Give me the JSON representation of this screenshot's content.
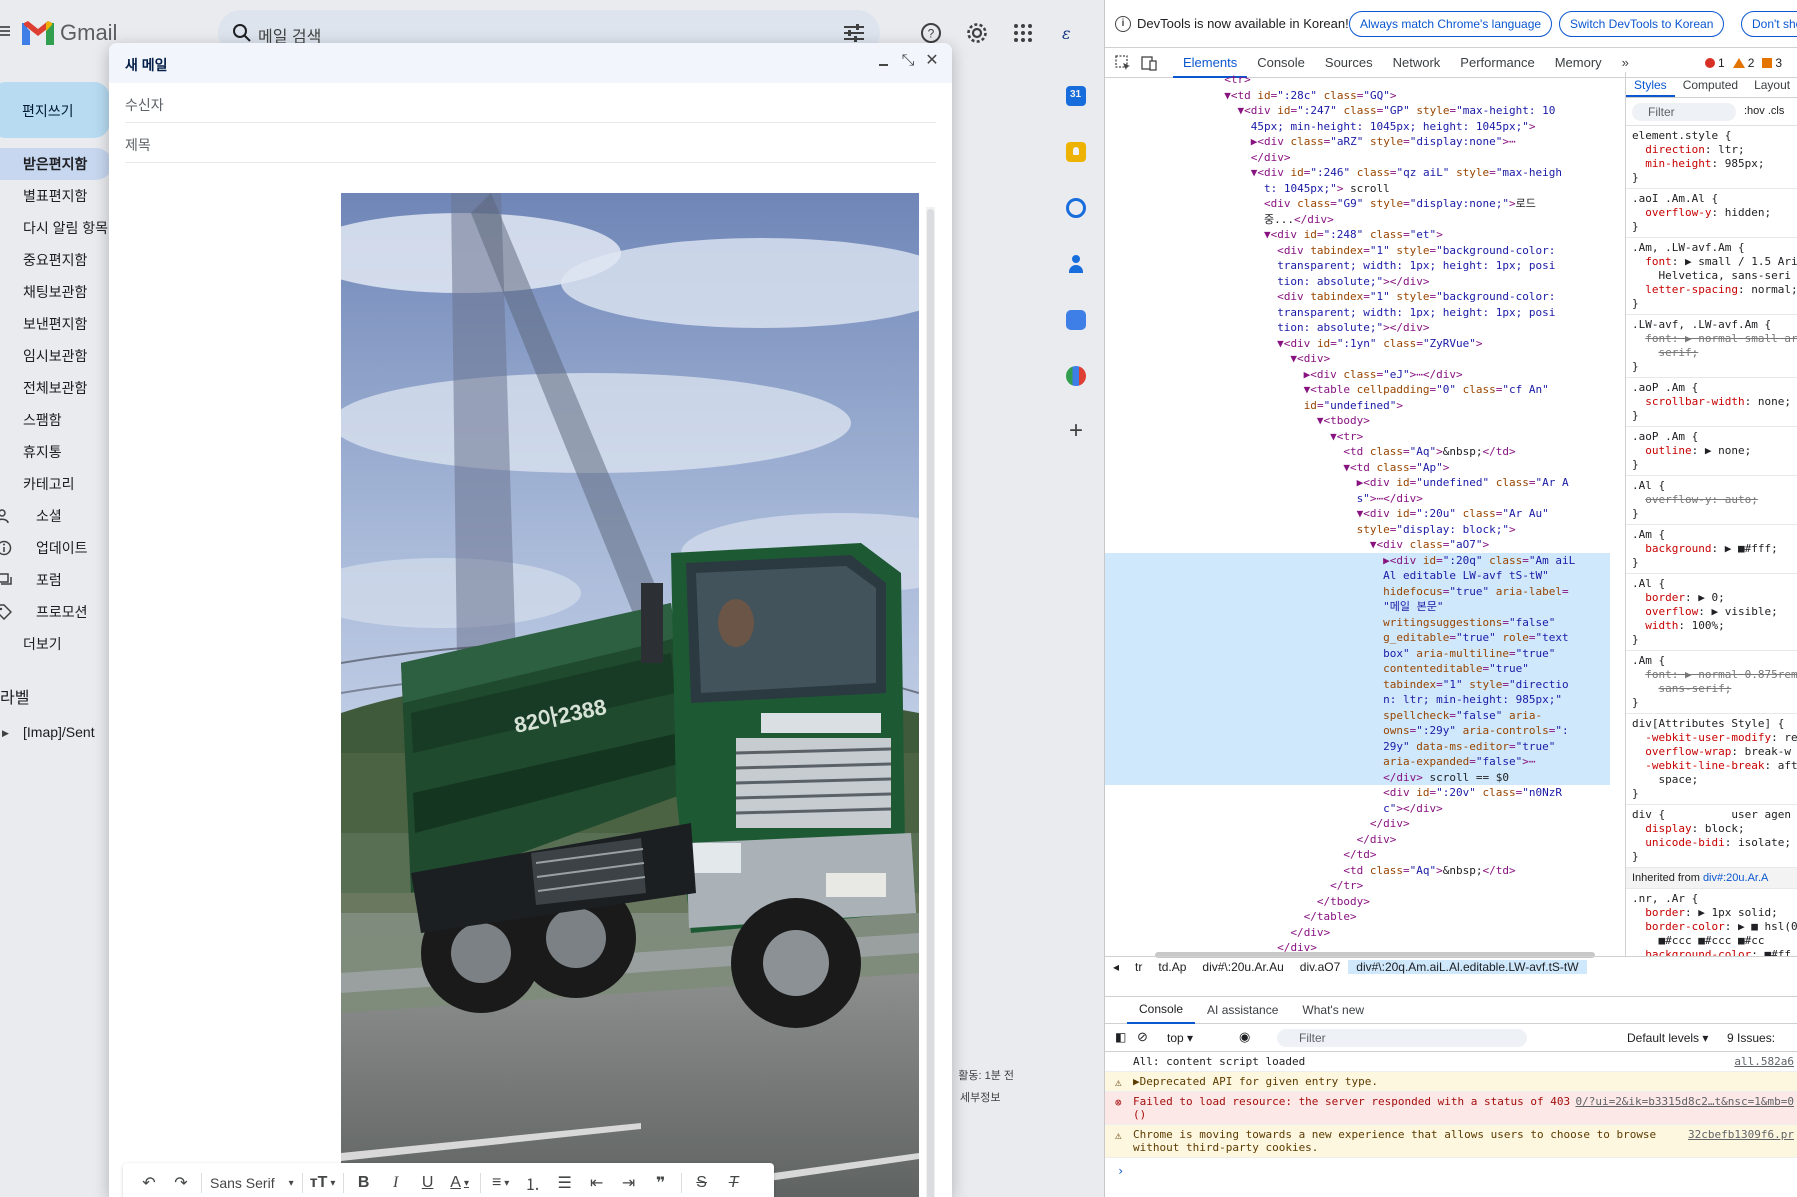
{
  "gmail": {
    "brand": "Gmail",
    "search_placeholder": "메일 검색",
    "compose_label": "편지쓰기",
    "nav": [
      {
        "label": "받은편지함",
        "active": true
      },
      {
        "label": "별표편지함"
      },
      {
        "label": "다시 알림 항목"
      },
      {
        "label": "중요편지함"
      },
      {
        "label": "채팅보관함"
      },
      {
        "label": "보낸편지함"
      },
      {
        "label": "임시보관함"
      },
      {
        "label": "전체보관함"
      },
      {
        "label": "스팸함"
      },
      {
        "label": "휴지통"
      },
      {
        "label": "카테고리"
      },
      {
        "label": "소셜"
      },
      {
        "label": "업데이트"
      },
      {
        "label": "포럼"
      },
      {
        "label": "프로모션"
      },
      {
        "label": "더보기"
      }
    ],
    "labels_heading": "라벨",
    "label_item": "[Imap]/Sent",
    "activity": "활동: 1분 전",
    "details": "세부정보"
  },
  "compose": {
    "title": "새 메일",
    "to_placeholder": "수신자",
    "subject_placeholder": "제목",
    "font": "Sans Serif"
  },
  "devtools": {
    "info_message": "DevTools is now available in Korean!",
    "btn_match": "Always match Chrome's language",
    "btn_switch": "Switch DevTools to Korean",
    "btn_dont": "Don't show",
    "tabs": [
      "Elements",
      "Console",
      "Sources",
      "Network",
      "Performance",
      "Memory"
    ],
    "errors": "1",
    "warnings": "2",
    "issues": "3",
    "styles_tabs": [
      "Styles",
      "Computed",
      "Layout"
    ],
    "styles_filter": "Filter",
    "hov": ":hov  .cls",
    "inherited": "Inherited from",
    "inherited_target": "div#:20u.Ar.A",
    "crumbs": [
      "tr",
      "td.Ap",
      "div#\\:20u.Ar.Au",
      "div.aO7",
      "div#\\:20q.Am.aiL.Al.editable.LW-avf.tS-tW"
    ],
    "drawer_tabs": [
      "Console",
      "AI assistance",
      "What's new"
    ],
    "context": "top",
    "console_filter": "Filter",
    "levels": "Default levels",
    "issue_count": "9 Issues:",
    "console": [
      {
        "type": "log",
        "text": "All: content script loaded",
        "src": "all.582a6"
      },
      {
        "type": "warn",
        "text": "▶Deprecated API for given entry type.",
        "src": ""
      },
      {
        "type": "err",
        "text": "Failed to load resource: the server responded with a status of 403\n()",
        "src": "0/?ui=2&ik=b3315d8c2…t&nsc=1&mb=0"
      },
      {
        "type": "warn",
        "text": "Chrome is moving towards a new experience that allows users to choose to browse\nwithout third-party cookies.",
        "src": "32cbefb1309f6.pr"
      }
    ]
  }
}
